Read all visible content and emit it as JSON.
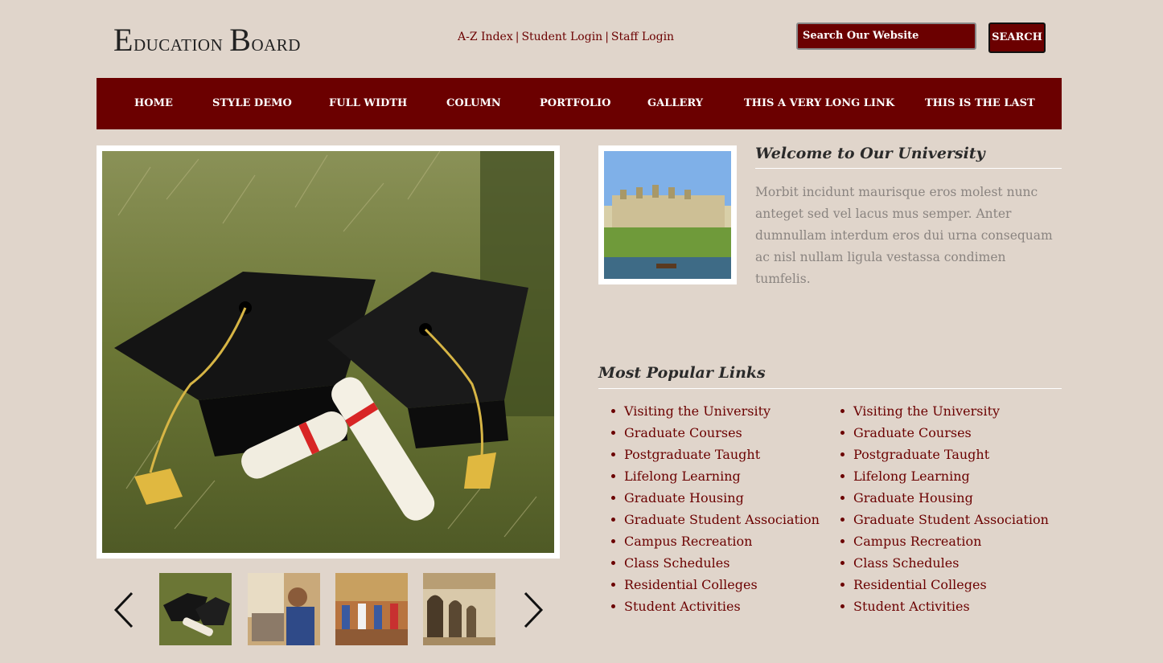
{
  "header": {
    "title_first_letter": "E",
    "title_rest_1": "ducation ",
    "title_second_letter": "B",
    "title_rest_2": "oard",
    "top_links": [
      "A-Z Index",
      "Student Login",
      "Staff Login"
    ],
    "separator": "|",
    "search_value": "Search Our Website",
    "search_button": "SEARCH"
  },
  "nav": {
    "items": [
      "HOME",
      "STYLE DEMO",
      "FULL WIDTH",
      "COLUMN",
      "PORTFOLIO",
      "GALLERY",
      "THIS A VERY LONG LINK",
      "THIS IS THE LAST"
    ]
  },
  "slider": {
    "prev_icon": "chevron-left-icon",
    "next_icon": "chevron-right-icon"
  },
  "welcome": {
    "title": "Welcome to Our University",
    "text": "Morbit incidunt maurisque eros molest nunc anteget sed vel lacus mus semper. Anter dumnullam interdum eros dui urna consequam ac nisl nullam ligula vestassa condimen tumfelis."
  },
  "popular": {
    "title": "Most Popular Links",
    "col1": [
      "Visiting the University",
      "Graduate Courses",
      "Postgraduate Taught",
      "Lifelong Learning",
      "Graduate Housing",
      "Graduate Student Association",
      "Campus Recreation",
      "Class Schedules",
      "Residential Colleges",
      "Student Activities"
    ],
    "col2": [
      "Visiting the University",
      "Graduate Courses",
      "Postgraduate Taught",
      "Lifelong Learning",
      "Graduate Housing",
      "Graduate Student Association",
      "Campus Recreation",
      "Class Schedules",
      "Residential Colleges",
      "Student Activities"
    ]
  },
  "colors": {
    "brand": "#6b0000",
    "background": "#e0d5cb",
    "muted_text": "#8a8480"
  }
}
